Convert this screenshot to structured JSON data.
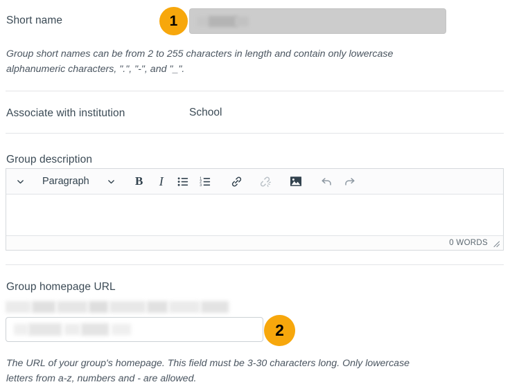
{
  "form": {
    "short_name": {
      "label": "Short name",
      "value": "",
      "redacted": true,
      "disabled": true,
      "help": "Group short names can be from 2 to 255 characters in length and contain only lowercase alphanumeric characters, \".\", \"-\", and \"_\"."
    },
    "institution": {
      "label": "Associate with institution",
      "value": "School"
    },
    "group_description": {
      "label": "Group description",
      "editor": {
        "format_select": "Paragraph",
        "word_count": "0 WORDS",
        "content": "",
        "buttons": [
          {
            "name": "toggle-toolbar-chevron-icon",
            "glyph": "⌄",
            "disabled": false
          },
          {
            "name": "format-select",
            "label": "Paragraph",
            "disabled": false
          },
          {
            "name": "format-chevron-down-icon",
            "glyph": "⌄",
            "disabled": false
          },
          {
            "name": "bold-button",
            "label": "B",
            "disabled": false
          },
          {
            "name": "italic-button",
            "label": "I",
            "disabled": false
          },
          {
            "name": "bullet-list-button",
            "disabled": false
          },
          {
            "name": "numbered-list-button",
            "disabled": false
          },
          {
            "name": "link-button",
            "disabled": false
          },
          {
            "name": "unlink-button",
            "disabled": true
          },
          {
            "name": "insert-image-button",
            "disabled": false
          },
          {
            "name": "undo-button",
            "disabled": false
          },
          {
            "name": "redo-button",
            "disabled": false
          }
        ]
      }
    },
    "homepage_url": {
      "label": "Group homepage URL",
      "prefix": "",
      "prefix_redacted": true,
      "value": "",
      "value_redacted": true,
      "help": "The URL of your group's homepage. This field must be 3-30 characters long. Only lowercase letters from a-z, numbers and - are allowed."
    }
  },
  "annotations": {
    "badge_1": "1",
    "badge_2": "2",
    "accent_color": "#f7a70c"
  }
}
